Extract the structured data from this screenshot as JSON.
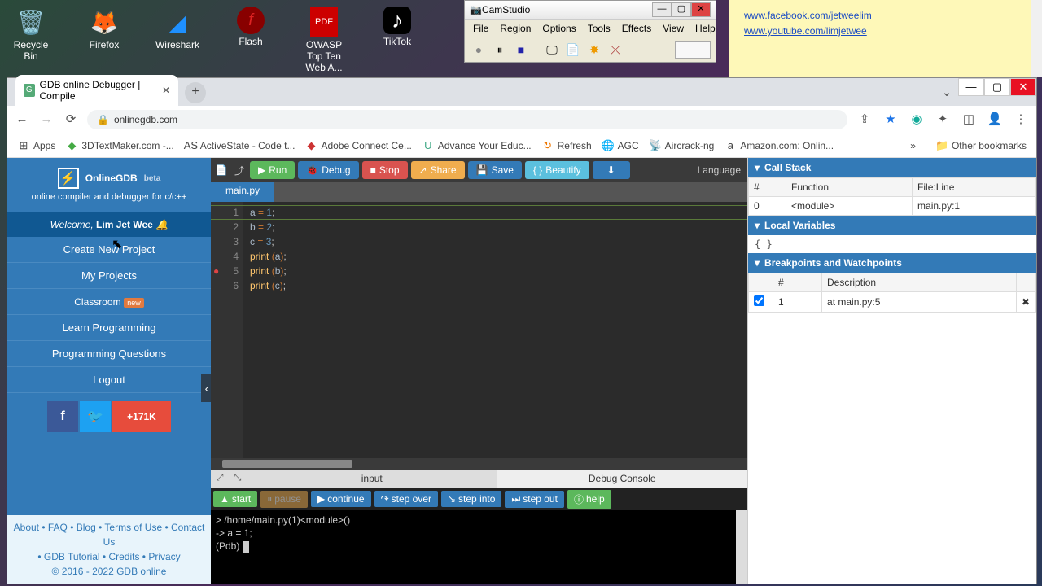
{
  "desktop": {
    "icons": [
      "Recycle Bin",
      "Firefox",
      "Wireshark",
      "Flash",
      "OWASP Top Ten Web A...",
      "TikTok"
    ]
  },
  "camstudio": {
    "title": "CamStudio",
    "menu": [
      "File",
      "Region",
      "Options",
      "Tools",
      "Effects",
      "View",
      "Help"
    ]
  },
  "sticky": {
    "line1": "www.facebook.com/jetweelim",
    "line2": "www.youtube.com/limjetwee"
  },
  "chrome": {
    "tab_title": "GDB online Debugger | Compile",
    "url": "onlinegdb.com",
    "bookmarks": [
      "Apps",
      "3DTextMaker.com -...",
      "ActiveState - Code t...",
      "Adobe Connect Ce...",
      "Advance Your Educ...",
      "Refresh",
      "AGC",
      "Aircrack-ng",
      "Amazon.com: Onlin..."
    ],
    "other_bookmarks": "Other bookmarks"
  },
  "sidebar": {
    "brand": "OnlineGDB",
    "beta": "beta",
    "tagline": "online compiler and debugger for c/c++",
    "welcome_pre": "Welcome, ",
    "welcome_name": "Lim Jet Wee",
    "menu": [
      "Create New Project",
      "My Projects",
      "Classroom",
      "Learn Programming",
      "Programming Questions",
      "Logout"
    ],
    "new_badge": "new",
    "share_count": "171K",
    "footer_links": "About • FAQ • Blog • Terms of Use • Contact Us",
    "footer_links2": "• GDB Tutorial • Credits • Privacy",
    "copyright": "© 2016 - 2022 GDB online"
  },
  "toolbar": {
    "run": "Run",
    "debug": "Debug",
    "stop": "Stop",
    "share": "Share",
    "save": "Save",
    "beautify": "Beautify",
    "language_label": "Language"
  },
  "editor": {
    "tab": "main.py",
    "lines": [
      {
        "n": 1,
        "a": "a",
        "op": "=",
        "v": "1"
      },
      {
        "n": 2,
        "a": "b",
        "op": "=",
        "v": "2"
      },
      {
        "n": 3,
        "a": "c",
        "op": "=",
        "v": "3"
      },
      {
        "n": 4,
        "fn": "print",
        "arg": "a"
      },
      {
        "n": 5,
        "fn": "print",
        "arg": "b",
        "bp": true
      },
      {
        "n": 6,
        "fn": "print",
        "arg": "c"
      }
    ]
  },
  "console_tabs": {
    "input": "input",
    "debug": "Debug Console"
  },
  "dbgbar": {
    "start": "start",
    "pause": "pause",
    "continue": "continue",
    "stepover": "step over",
    "stepinto": "step into",
    "stepout": "step out",
    "help": "help"
  },
  "console": {
    "l1": "> /home/main.py(1)<module>()",
    "l2": "-> a = 1;",
    "l3": "(Pdb) "
  },
  "callstack": {
    "title": "Call Stack",
    "cols": [
      "#",
      "Function",
      "File:Line"
    ],
    "row": {
      "n": "0",
      "fn": "<module>",
      "loc": "main.py:1"
    }
  },
  "locals": {
    "title": "Local Variables",
    "body": "{ }"
  },
  "breakpoints": {
    "title": "Breakpoints and Watchpoints",
    "cols": [
      "#",
      "Description"
    ],
    "row": {
      "n": "1",
      "desc": "at main.py:5"
    }
  }
}
